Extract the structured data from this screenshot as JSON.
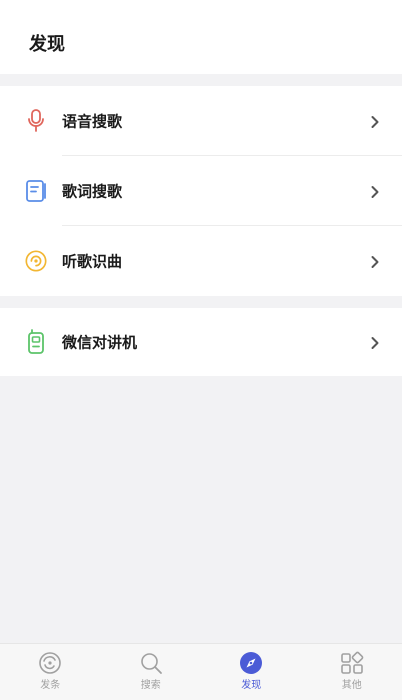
{
  "header": {
    "title": "发现"
  },
  "groups": [
    {
      "items": [
        {
          "label": "语音搜歌",
          "icon": "microphone-icon",
          "color": "#e0665c"
        },
        {
          "label": "歌词搜歌",
          "icon": "lyrics-document-icon",
          "color": "#5a8de8"
        },
        {
          "label": "听歌识曲",
          "icon": "music-recognition-icon",
          "color": "#f2b632"
        }
      ]
    },
    {
      "items": [
        {
          "label": "微信对讲机",
          "icon": "walkie-talkie-icon",
          "color": "#5cc46a"
        }
      ]
    }
  ],
  "tabbar": {
    "active_color": "#4b5bd6",
    "inactive_color": "#a0a0a0",
    "tabs": [
      {
        "label": "发条",
        "icon": "clockwork-icon",
        "active": false
      },
      {
        "label": "搜索",
        "icon": "search-icon",
        "active": false
      },
      {
        "label": "发现",
        "icon": "compass-icon",
        "active": true
      },
      {
        "label": "其他",
        "icon": "grid-apps-icon",
        "active": false
      }
    ]
  }
}
